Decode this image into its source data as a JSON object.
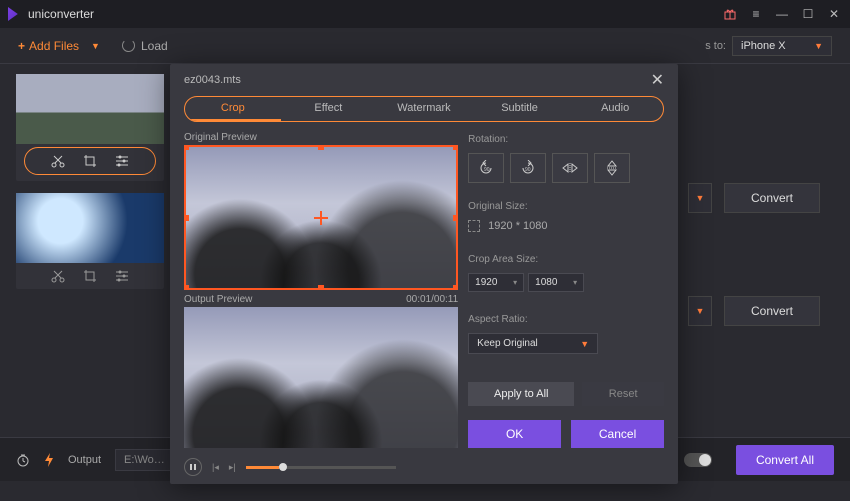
{
  "app": {
    "title": "uniconverter"
  },
  "window_controls": {
    "gift": "gift-icon",
    "menu": "≡",
    "min": "—",
    "max": "☐",
    "close": "✕"
  },
  "toolbar": {
    "add_files": "Add Files",
    "load": "Load",
    "output_to_label": "s to:",
    "output_target": "iPhone X"
  },
  "clips": {
    "tools": [
      "cut",
      "crop",
      "adjust"
    ]
  },
  "convert_label": "Convert",
  "bottom": {
    "output_label": "Output",
    "output_path": "E:\\Wo…",
    "merge_label": "",
    "convert_all": "Convert All"
  },
  "editor": {
    "filename": "ez0043.mts",
    "tabs": [
      "Crop",
      "Effect",
      "Watermark",
      "Subtitle",
      "Audio"
    ],
    "active_tab": 0,
    "original_preview_label": "Original Preview",
    "output_preview_label": "Output Preview",
    "timecode": "00:01/00:11",
    "settings": {
      "rotation_label": "Rotation:",
      "rotation_buttons": [
        "rotate-left-90",
        "rotate-right-90",
        "flip-horizontal",
        "flip-vertical"
      ],
      "original_size_label": "Original Size:",
      "original_size_value": "1920 * 1080",
      "crop_area_label": "Crop Area Size:",
      "crop_w": "1920",
      "crop_h": "1080",
      "aspect_label": "Aspect Ratio:",
      "aspect_value": "Keep Original",
      "apply_all": "Apply to All",
      "reset": "Reset",
      "ok": "OK",
      "cancel": "Cancel"
    }
  },
  "colors": {
    "accent": "#ff8a37",
    "primary": "#7a4fe0"
  }
}
